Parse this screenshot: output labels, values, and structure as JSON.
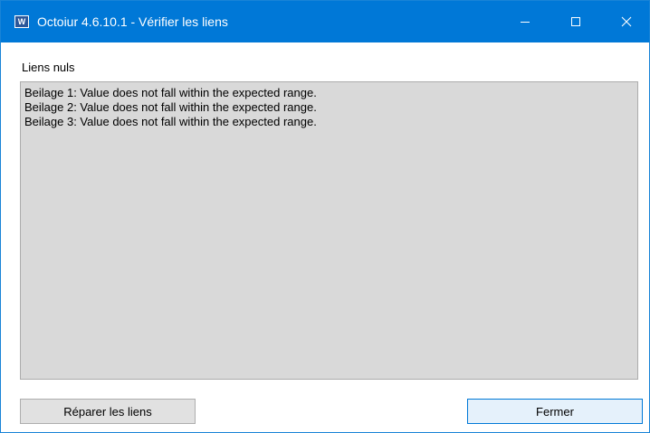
{
  "window": {
    "title": "Octoiur 4.6.10.1 - Vérifier les liens",
    "app_icon_letter": "W",
    "accent_color": "#0078d7"
  },
  "main": {
    "section_label": "Liens nuls",
    "errors": [
      "Beilage 1: Value does not fall within the expected range.",
      "Beilage 2: Value does not fall within the expected range.",
      "Beilage 3: Value does not fall within the expected range."
    ]
  },
  "buttons": {
    "repair_label": "Réparer les liens",
    "close_label": "Fermer"
  },
  "icons": {
    "app": "word-icon",
    "minimize": "minimize-icon",
    "maximize": "maximize-icon",
    "close": "close-icon"
  }
}
